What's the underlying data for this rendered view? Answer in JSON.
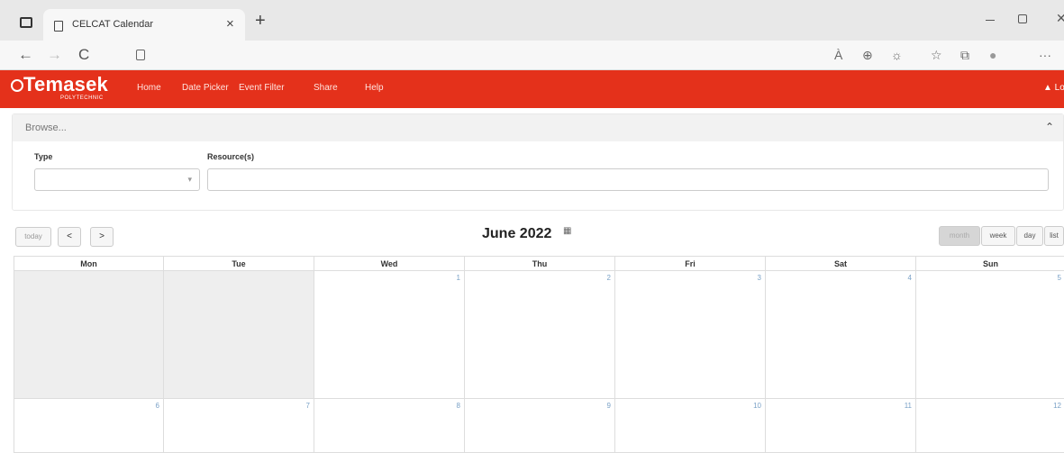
{
  "browser": {
    "tab_title": "CELCAT Calendar",
    "tab_close": "×",
    "new_tab": "+",
    "back": "←",
    "forward": "→",
    "reload": "C",
    "read_aloud": "À",
    "zoom": "⊕",
    "tracking": "☼",
    "favorites": "☆",
    "collections": "⧉",
    "profile": "●",
    "more": "···"
  },
  "app": {
    "logo": "Temasek",
    "logo_sub": "POLYTECHNIC",
    "nav": [
      "Home",
      "Date Picker",
      "Event Filter",
      "Share",
      "Help"
    ],
    "login": "▲ Log In"
  },
  "browse": {
    "title": "Browse...",
    "type_label": "Type",
    "resources_label": "Resource(s)",
    "type_value": "",
    "resources_value": ""
  },
  "toolbar": {
    "today": "today",
    "prev": "<",
    "next": ">",
    "title": "June 2022",
    "views": [
      "month",
      "week",
      "day",
      "list"
    ],
    "active_view": "month"
  },
  "calendar": {
    "days": [
      "Mon",
      "Tue",
      "Wed",
      "Thu",
      "Fri",
      "Sat",
      "Sun"
    ],
    "week1": [
      "",
      "",
      "1",
      "2",
      "3",
      "4",
      "5"
    ],
    "week2": [
      "6",
      "7",
      "8",
      "9",
      "10",
      "11",
      "12"
    ]
  },
  "colors": {
    "brand": "#e4311b",
    "daynum": "#7ba2c7",
    "other_month": "#eeeeee"
  }
}
